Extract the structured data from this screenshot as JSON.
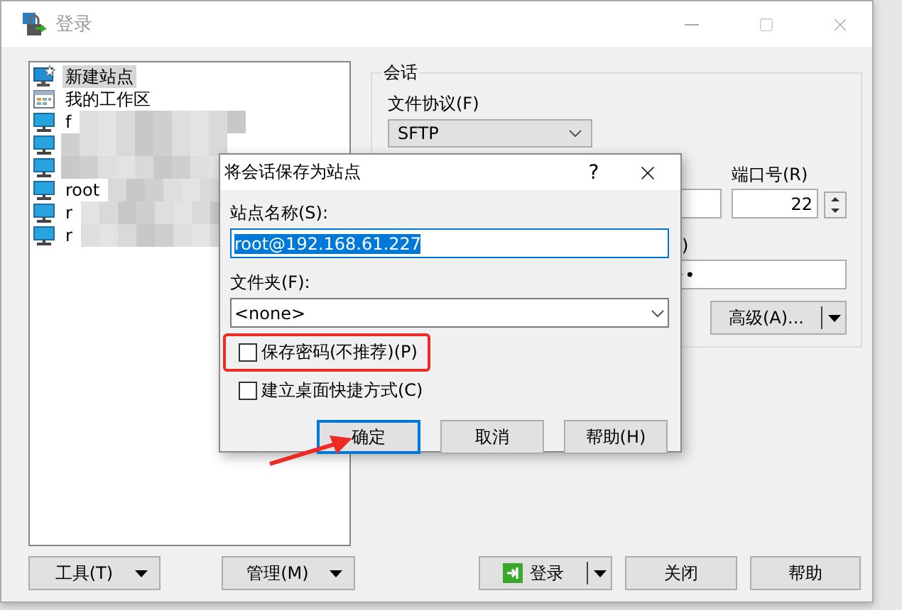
{
  "window": {
    "title": "登录",
    "active": false
  },
  "sites": [
    {
      "kind": "new",
      "label": "新建站点",
      "selected": true,
      "redacted": false
    },
    {
      "kind": "workspace",
      "label": "我的工作区",
      "selected": false,
      "redacted": false
    },
    {
      "kind": "host",
      "label": "f",
      "selected": false,
      "redacted": true
    },
    {
      "kind": "host",
      "selected": false,
      "redacted": true
    },
    {
      "kind": "host",
      "selected": false,
      "redacted": true
    },
    {
      "kind": "host",
      "label": "root",
      "selected": false,
      "redacted": true
    },
    {
      "kind": "host",
      "label": "r",
      "selected": false,
      "redacted": true
    },
    {
      "kind": "host",
      "label": "r",
      "selected": false,
      "redacted": true
    }
  ],
  "session": {
    "group": "会话",
    "protocol_label": "文件协议(F)",
    "protocol": "SFTP",
    "port_label": "端口号(R)",
    "port": "22",
    "password_label": ")",
    "password": "••",
    "advanced_button": "高级(A)..."
  },
  "bottom_buttons": [
    {
      "kind": "menu",
      "label": "工具(T)"
    },
    {
      "kind": "menu",
      "label": "管理(M)"
    },
    {
      "kind": "spacer"
    },
    {
      "kind": "login",
      "label": "登录"
    },
    {
      "kind": "plain",
      "label": "关闭"
    },
    {
      "kind": "plain",
      "label": "帮助"
    }
  ],
  "dialog": {
    "title": "将会话保存为站点",
    "help": "?",
    "name_label": "站点名称(S):",
    "name": "root@192.168.61.227",
    "name_selected": true,
    "folder_label": "文件夹(F):",
    "folder": "<none>",
    "options": [
      {
        "label": "保存密码(不推荐)(P)",
        "checked": false,
        "highlighted": true
      },
      {
        "label": "建立桌面快捷方式(C)",
        "checked": false,
        "highlighted": false
      }
    ],
    "buttons": [
      {
        "label": "确定",
        "focused": true,
        "pointed": true
      },
      {
        "label": "取消",
        "focused": false,
        "pointed": false
      },
      {
        "label": "帮助(H)",
        "focused": false,
        "pointed": false
      }
    ]
  }
}
